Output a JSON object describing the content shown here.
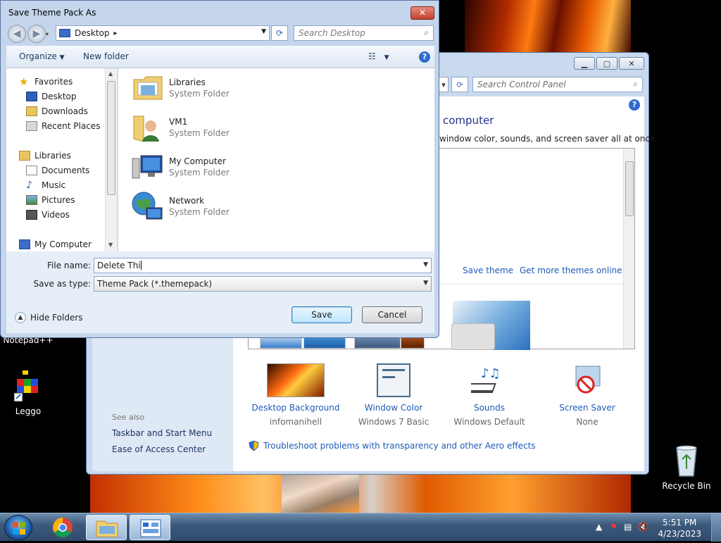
{
  "dialog": {
    "title": "Save Theme Pack As",
    "close_label": "✕",
    "address": "Desktop",
    "search_placeholder": "Search Desktop",
    "toolbar": {
      "organize": "Organize",
      "new_folder": "New folder"
    },
    "nav": {
      "favorites": "Favorites",
      "desktop": "Desktop",
      "downloads": "Downloads",
      "recent_places": "Recent Places",
      "libraries": "Libraries",
      "documents": "Documents",
      "music": "Music",
      "pictures": "Pictures",
      "videos": "Videos",
      "my_computer": "My Computer"
    },
    "files": [
      {
        "name": "Libraries",
        "type": "System Folder"
      },
      {
        "name": "VM1",
        "type": "System Folder"
      },
      {
        "name": "My Computer",
        "type": "System Folder"
      },
      {
        "name": "Network",
        "type": "System Folder"
      }
    ],
    "file_name_label": "File name:",
    "file_name_value": "Delete Thi",
    "save_as_type_label": "Save as type:",
    "save_as_type_value": "Theme Pack (*.themepack)",
    "hide_folders": "Hide Folders",
    "save": "Save",
    "cancel": "Cancel"
  },
  "control_panel": {
    "search_placeholder": "Search Control Panel",
    "heading": "computer",
    "subtitle": "window color, sounds, and screen saver all at once.",
    "save_theme": "Save theme",
    "get_more_themes": "Get more themes online",
    "items": [
      {
        "name": "Desktop Background",
        "value": "infomanihell"
      },
      {
        "name": "Window Color",
        "value": "Windows 7 Basic"
      },
      {
        "name": "Sounds",
        "value": "Windows Default"
      },
      {
        "name": "Screen Saver",
        "value": "None"
      }
    ],
    "troubleshoot": "Troubleshoot problems with transparency and other Aero effects",
    "see_also": "See also",
    "taskbar_link": "Taskbar and Start Menu",
    "ease_link": "Ease of Access Center"
  },
  "desktop": {
    "notepad_label": "Notepad++",
    "leggo_label": "Leggo",
    "recycle_label": "Recycle Bin"
  },
  "taskbar": {
    "time": "5:51 PM",
    "date": "4/23/2023"
  },
  "colors": {
    "accent": "#1e5bb8",
    "title_blue": "#1e3287"
  }
}
